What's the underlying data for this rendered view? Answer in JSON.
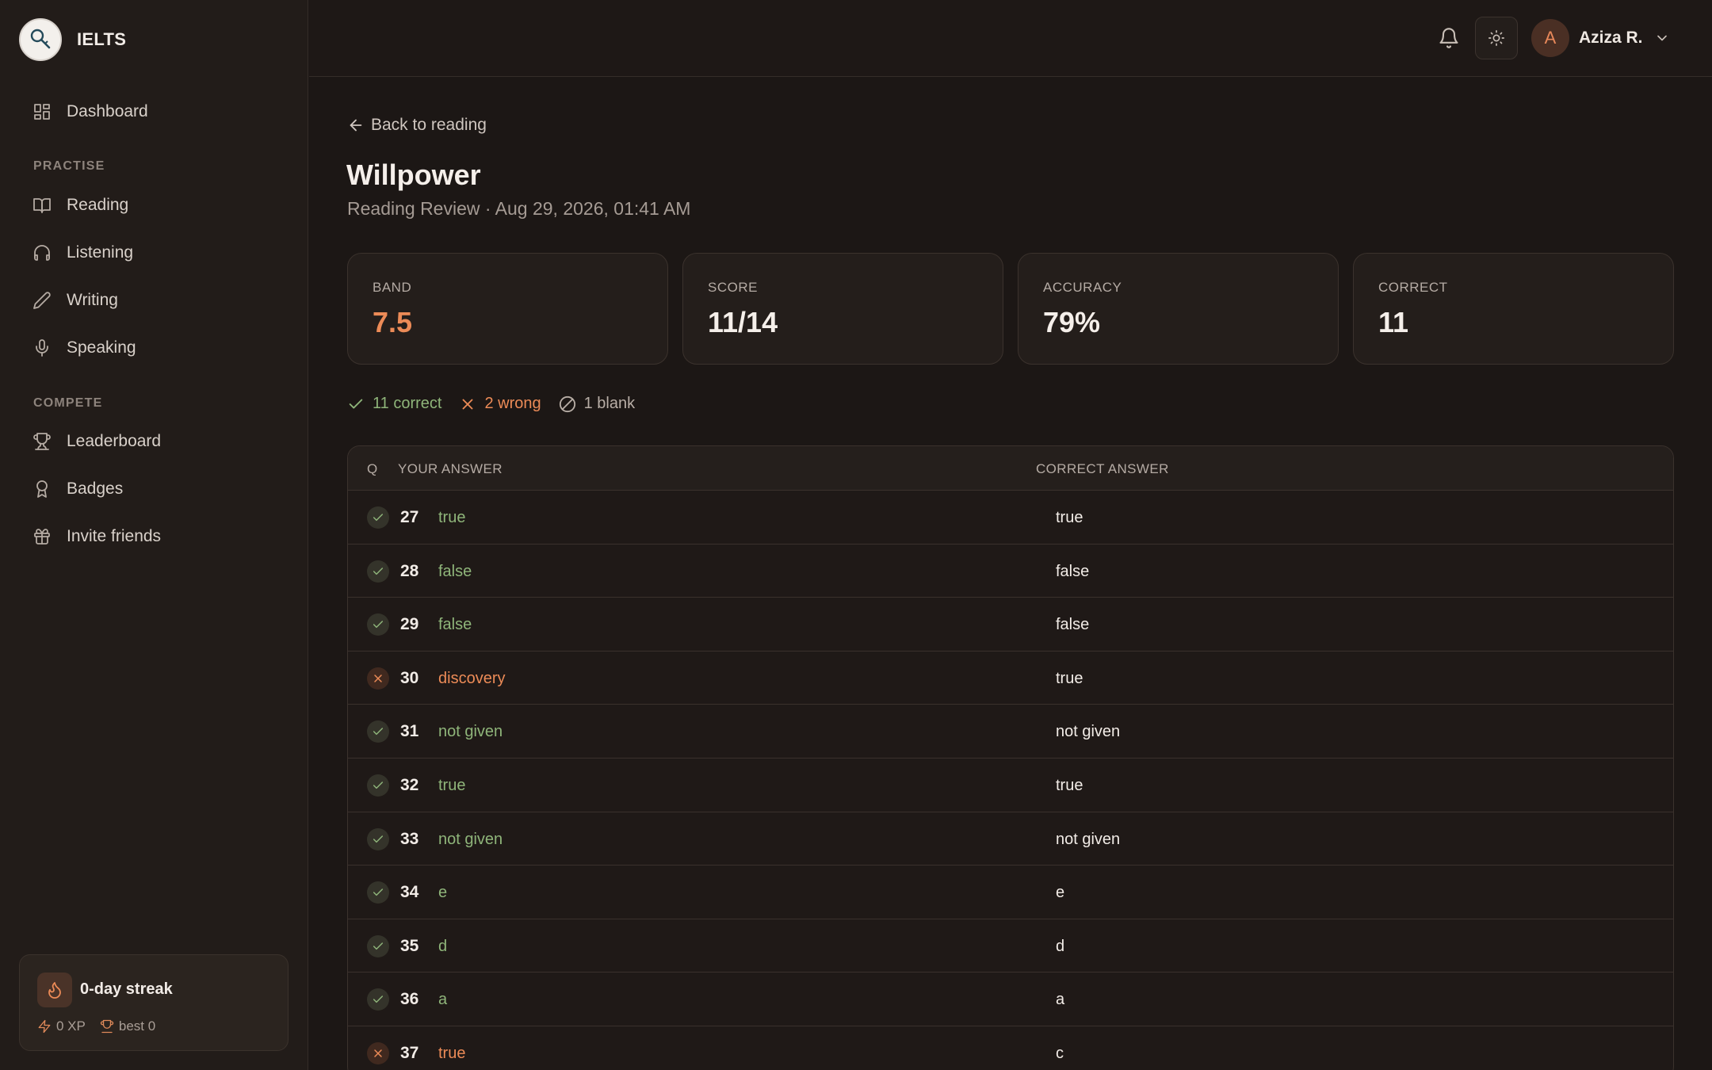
{
  "brand": {
    "name": "IELTS"
  },
  "nav": {
    "dashboard": "Dashboard",
    "practise_label": "PRACTISE",
    "reading": "Reading",
    "listening": "Listening",
    "writing": "Writing",
    "speaking": "Speaking",
    "compete_label": "COMPETE",
    "leaderboard": "Leaderboard",
    "badges": "Badges",
    "invite": "Invite friends"
  },
  "streak": {
    "title": "0-day streak",
    "xp": "0 XP",
    "best": "best 0"
  },
  "user": {
    "initial": "A",
    "name": "Aziza R."
  },
  "page": {
    "back": "Back to reading",
    "title": "Willpower",
    "subtitle": "Reading Review · Aug 29, 2026, 01:41 AM"
  },
  "stats": {
    "band_label": "BAND",
    "band_value": "7.5",
    "score_label": "SCORE",
    "score_value": "11/14",
    "accuracy_label": "ACCURACY",
    "accuracy_value": "79%",
    "correct_label": "CORRECT",
    "correct_value": "11"
  },
  "summary": {
    "correct": "11 correct",
    "wrong": "2 wrong",
    "blank": "1 blank"
  },
  "table": {
    "col_q": "Q",
    "col_your": "YOUR ANSWER",
    "col_correct": "CORRECT ANSWER",
    "rows": [
      {
        "q": "27",
        "answer": "true",
        "correct": "true",
        "status": "ok"
      },
      {
        "q": "28",
        "answer": "false",
        "correct": "false",
        "status": "ok"
      },
      {
        "q": "29",
        "answer": "false",
        "correct": "false",
        "status": "ok"
      },
      {
        "q": "30",
        "answer": "discovery",
        "correct": "true",
        "status": "bad"
      },
      {
        "q": "31",
        "answer": "not given",
        "correct": "not given",
        "status": "ok"
      },
      {
        "q": "32",
        "answer": "true",
        "correct": "true",
        "status": "ok"
      },
      {
        "q": "33",
        "answer": "not given",
        "correct": "not given",
        "status": "ok"
      },
      {
        "q": "34",
        "answer": "e",
        "correct": "e",
        "status": "ok"
      },
      {
        "q": "35",
        "answer": "d",
        "correct": "d",
        "status": "ok"
      },
      {
        "q": "36",
        "answer": "a",
        "correct": "a",
        "status": "ok"
      },
      {
        "q": "37",
        "answer": "true",
        "correct": "c",
        "status": "bad"
      }
    ]
  },
  "colors": {
    "accent": "#ec8b57",
    "success": "#8fb57a",
    "background": "#1c1715"
  }
}
